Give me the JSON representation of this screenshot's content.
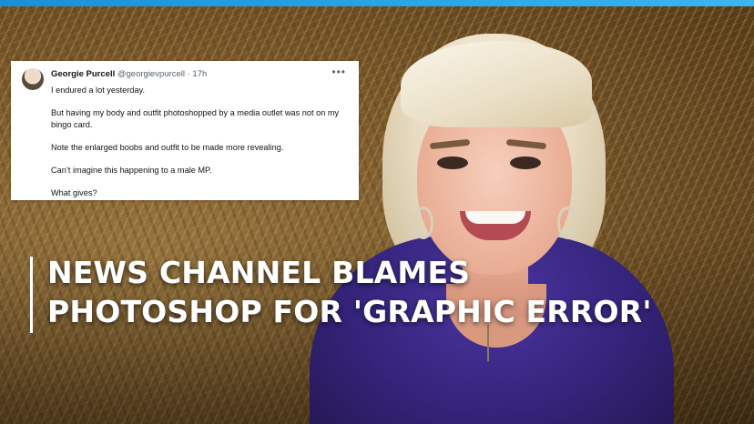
{
  "tweet": {
    "name": "Georgie Purcell",
    "handle": "@georgievpurcell",
    "separator": "·",
    "time": "17h",
    "more_icon": "more-horizontal-icon",
    "lines": [
      "I endured a lot yesterday.",
      "But having my body and outfit photoshopped by a media outlet was not on my bingo card.",
      "Note the enlarged boobs and outfit to be made more revealing.",
      "Can’t imagine this happening to a male MP.",
      "What gives?"
    ]
  },
  "headline": {
    "line1": "NEWS CHANNEL BLAMES",
    "line2": "PHOTOSHOP FOR 'GRAPHIC ERROR'"
  },
  "colors": {
    "top_bar": "#2aa8e8",
    "headline_text": "#ffffff",
    "top_garment": "#34247a"
  }
}
